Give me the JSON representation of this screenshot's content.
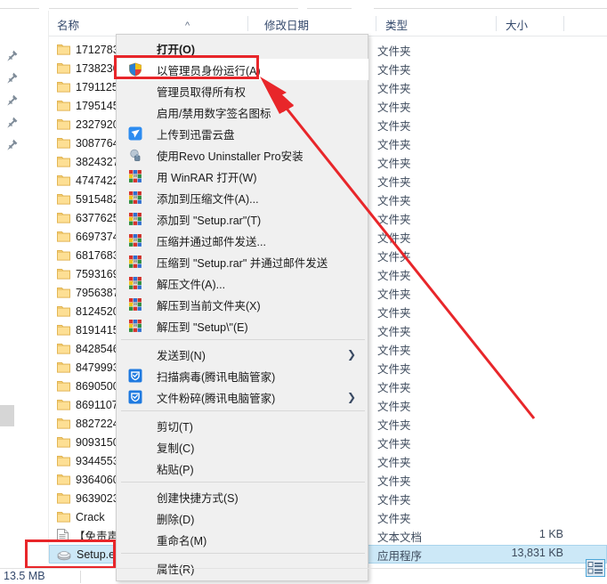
{
  "window": {
    "app": "Windows File Explorer",
    "columns": [
      {
        "id": "name",
        "label": "名称",
        "sorted": true,
        "sort_caret": "^"
      },
      {
        "id": "date",
        "label": "修改日期"
      },
      {
        "id": "type",
        "label": "类型"
      },
      {
        "id": "size",
        "label": "大小"
      }
    ]
  },
  "files": [
    {
      "name": "1712783",
      "icon": "folder-icon",
      "type": "文件夹",
      "size": "",
      "selected": false
    },
    {
      "name": "1738230",
      "icon": "folder-icon",
      "type": "文件夹",
      "size": "",
      "selected": false
    },
    {
      "name": "1791125",
      "icon": "folder-icon",
      "type": "文件夹",
      "size": "",
      "selected": false
    },
    {
      "name": "1795145",
      "icon": "folder-icon",
      "type": "文件夹",
      "size": "",
      "selected": false
    },
    {
      "name": "2327920",
      "icon": "folder-icon",
      "type": "文件夹",
      "size": "",
      "selected": false
    },
    {
      "name": "3087764",
      "icon": "folder-icon",
      "type": "文件夹",
      "size": "",
      "selected": false
    },
    {
      "name": "3824327",
      "icon": "folder-icon",
      "type": "文件夹",
      "size": "",
      "selected": false
    },
    {
      "name": "4747422",
      "icon": "folder-icon",
      "type": "文件夹",
      "size": "",
      "selected": false
    },
    {
      "name": "5915482",
      "icon": "folder-icon",
      "type": "文件夹",
      "size": "",
      "selected": false
    },
    {
      "name": "6377625",
      "icon": "folder-icon",
      "type": "文件夹",
      "size": "",
      "selected": false
    },
    {
      "name": "6697374",
      "icon": "folder-icon",
      "type": "文件夹",
      "size": "",
      "selected": false
    },
    {
      "name": "6817683",
      "icon": "folder-icon",
      "type": "文件夹",
      "size": "",
      "selected": false
    },
    {
      "name": "7593169",
      "icon": "folder-icon",
      "type": "文件夹",
      "size": "",
      "selected": false
    },
    {
      "name": "7956387",
      "icon": "folder-icon",
      "type": "文件夹",
      "size": "",
      "selected": false
    },
    {
      "name": "8124520",
      "icon": "folder-icon",
      "type": "文件夹",
      "size": "",
      "selected": false
    },
    {
      "name": "8191415",
      "icon": "folder-icon",
      "type": "文件夹",
      "size": "",
      "selected": false
    },
    {
      "name": "8428546",
      "icon": "folder-icon",
      "type": "文件夹",
      "size": "",
      "selected": false
    },
    {
      "name": "8479993",
      "icon": "folder-icon",
      "type": "文件夹",
      "size": "",
      "selected": false
    },
    {
      "name": "8690500",
      "icon": "folder-icon",
      "type": "文件夹",
      "size": "",
      "selected": false
    },
    {
      "name": "8691107",
      "icon": "folder-icon",
      "type": "文件夹",
      "size": "",
      "selected": false
    },
    {
      "name": "8827224",
      "icon": "folder-icon",
      "type": "文件夹",
      "size": "",
      "selected": false
    },
    {
      "name": "9093150",
      "icon": "folder-icon",
      "type": "文件夹",
      "size": "",
      "selected": false
    },
    {
      "name": "9344553",
      "icon": "folder-icon",
      "type": "文件夹",
      "size": "",
      "selected": false
    },
    {
      "name": "9364060",
      "icon": "folder-icon",
      "type": "文件夹",
      "size": "",
      "selected": false
    },
    {
      "name": "9639023",
      "icon": "folder-icon",
      "type": "文件夹",
      "size": "",
      "selected": false
    },
    {
      "name": "Crack",
      "icon": "folder-icon",
      "type": "文件夹",
      "size": "",
      "selected": false
    },
    {
      "name": "【免责声",
      "icon": "text-file-icon",
      "type": "文本文档",
      "size": "1 KB",
      "selected": false
    },
    {
      "name": "Setup.ex",
      "icon": "application-icon",
      "type": "应用程序",
      "size": "13,831 KB",
      "selected": true
    }
  ],
  "context_menu": {
    "items": [
      {
        "label": "打开(O)",
        "icon": "",
        "bold": true,
        "highlighted": false,
        "submenu": false,
        "separator_after": false
      },
      {
        "label": "以管理员身份运行(A)",
        "icon": "uac-shield-icon",
        "bold": false,
        "highlighted": true,
        "submenu": false,
        "separator_after": false
      },
      {
        "label": "管理员取得所有权",
        "icon": "",
        "bold": false,
        "highlighted": false,
        "submenu": false,
        "separator_after": false
      },
      {
        "label": "启用/禁用数字签名图标",
        "icon": "",
        "bold": false,
        "highlighted": false,
        "submenu": false,
        "separator_after": false
      },
      {
        "label": "上传到迅雷云盘",
        "icon": "thunder-cloud-icon",
        "bold": false,
        "highlighted": false,
        "submenu": false,
        "separator_after": false
      },
      {
        "label": "使用Revo Uninstaller Pro安装",
        "icon": "revo-uninstaller-icon",
        "bold": false,
        "highlighted": false,
        "submenu": false,
        "separator_after": false
      },
      {
        "label": "用 WinRAR 打开(W)",
        "icon": "winrar-icon",
        "bold": false,
        "highlighted": false,
        "submenu": false,
        "separator_after": false
      },
      {
        "label": "添加到压缩文件(A)...",
        "icon": "winrar-icon",
        "bold": false,
        "highlighted": false,
        "submenu": false,
        "separator_after": false
      },
      {
        "label": "添加到 \"Setup.rar\"(T)",
        "icon": "winrar-icon",
        "bold": false,
        "highlighted": false,
        "submenu": false,
        "separator_after": false
      },
      {
        "label": "压缩并通过邮件发送...",
        "icon": "winrar-icon",
        "bold": false,
        "highlighted": false,
        "submenu": false,
        "separator_after": false
      },
      {
        "label": "压缩到 \"Setup.rar\" 并通过邮件发送",
        "icon": "winrar-icon",
        "bold": false,
        "highlighted": false,
        "submenu": false,
        "separator_after": false
      },
      {
        "label": "解压文件(A)...",
        "icon": "winrar-icon",
        "bold": false,
        "highlighted": false,
        "submenu": false,
        "separator_after": false
      },
      {
        "label": "解压到当前文件夹(X)",
        "icon": "winrar-icon",
        "bold": false,
        "highlighted": false,
        "submenu": false,
        "separator_after": false
      },
      {
        "label": "解压到 \"Setup\\\"(E)",
        "icon": "winrar-icon",
        "bold": false,
        "highlighted": false,
        "submenu": false,
        "separator_after": true
      },
      {
        "label": "发送到(N)",
        "icon": "",
        "bold": false,
        "highlighted": false,
        "submenu": true,
        "separator_after": false
      },
      {
        "label": "扫描病毒(腾讯电脑管家)",
        "icon": "tencent-guard-icon",
        "bold": false,
        "highlighted": false,
        "submenu": false,
        "separator_after": false
      },
      {
        "label": "文件粉碎(腾讯电脑管家)",
        "icon": "tencent-guard-icon",
        "bold": false,
        "highlighted": false,
        "submenu": true,
        "separator_after": true
      },
      {
        "label": "剪切(T)",
        "icon": "",
        "bold": false,
        "highlighted": false,
        "submenu": false,
        "separator_after": false
      },
      {
        "label": "复制(C)",
        "icon": "",
        "bold": false,
        "highlighted": false,
        "submenu": false,
        "separator_after": false
      },
      {
        "label": "粘贴(P)",
        "icon": "",
        "bold": false,
        "highlighted": false,
        "submenu": false,
        "separator_after": true
      },
      {
        "label": "创建快捷方式(S)",
        "icon": "",
        "bold": false,
        "highlighted": false,
        "submenu": false,
        "separator_after": false
      },
      {
        "label": "删除(D)",
        "icon": "",
        "bold": false,
        "highlighted": false,
        "submenu": false,
        "separator_after": false
      },
      {
        "label": "重命名(M)",
        "icon": "",
        "bold": false,
        "highlighted": false,
        "submenu": false,
        "separator_after": true
      },
      {
        "label": "属性(R)",
        "icon": "",
        "bold": false,
        "highlighted": false,
        "submenu": false,
        "separator_after": false
      }
    ]
  },
  "status_bar": {
    "size_text": "13.5 MB",
    "view_icon": "details-view-icon"
  },
  "annotations": {
    "accent_color": "#e8262a",
    "highlight_box_label": "以管理员身份运行(A)",
    "target_box_label": "Setup.ex"
  },
  "nav_rail": {
    "pin_icon": "pin-icon",
    "pin_count": 5
  }
}
